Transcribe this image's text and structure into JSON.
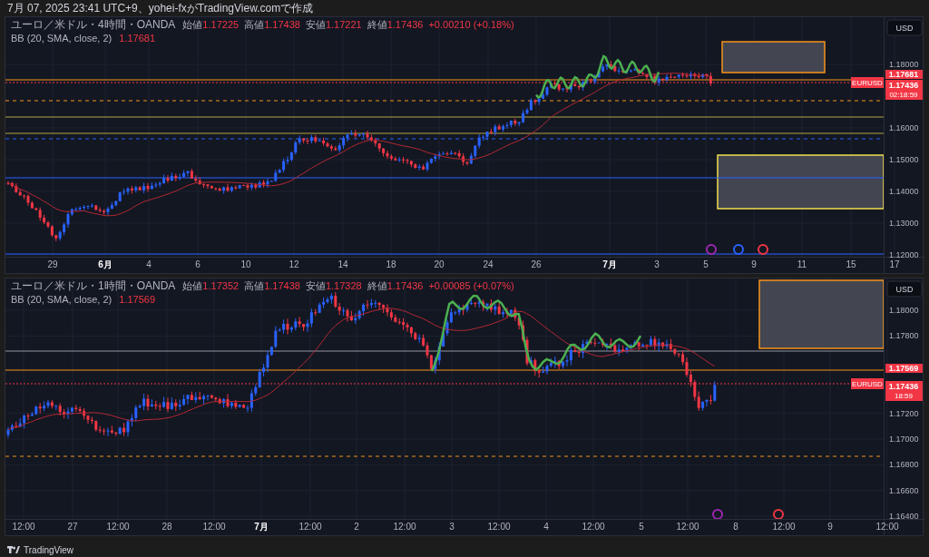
{
  "header": {
    "caption": "7月 07, 2025 23:41 UTC+9、yohei-fxがTradingView.comで作成"
  },
  "panels": [
    {
      "symbol_line": "ユーロ／米ドル・4時間・OANDA",
      "ohlc": [
        {
          "label": "始値",
          "value": "1.17225"
        },
        {
          "label": "高値",
          "value": "1.17438"
        },
        {
          "label": "安値",
          "value": "1.17221"
        },
        {
          "label": "終値",
          "value": "1.17436"
        }
      ],
      "change": "+0.00210 (+0.18%)",
      "indicator": {
        "label": "BB (20, SMA, close, 2)",
        "value": "1.17681"
      },
      "currency": "USD",
      "price_ticks": [
        "1.18000",
        "1.16000",
        "1.15000",
        "1.14000",
        "1.13000",
        "1.12000"
      ],
      "time_ticks": [
        {
          "label": "29",
          "emphasized": false
        },
        {
          "label": "6月",
          "emphasized": true
        },
        {
          "label": "4",
          "emphasized": false
        },
        {
          "label": "6",
          "emphasized": false
        },
        {
          "label": "10",
          "emphasized": false
        },
        {
          "label": "12",
          "emphasized": false
        },
        {
          "label": "14",
          "emphasized": false
        },
        {
          "label": "18",
          "emphasized": false
        },
        {
          "label": "20",
          "emphasized": false
        },
        {
          "label": "24",
          "emphasized": false
        },
        {
          "label": "26",
          "emphasized": false
        },
        {
          "label": "7月",
          "emphasized": true
        },
        {
          "label": "3",
          "emphasized": false
        },
        {
          "label": "5",
          "emphasized": false
        },
        {
          "label": "9",
          "emphasized": false
        },
        {
          "label": "11",
          "emphasized": false
        },
        {
          "label": "15",
          "emphasized": false
        },
        {
          "label": "17",
          "emphasized": false
        }
      ],
      "indicator_tag": "1.17681",
      "symbol_tag": "EURUSD",
      "last_price": "1.17436",
      "countdown": "02:18:59"
    },
    {
      "symbol_line": "ユーロ／米ドル・1時間・OANDA",
      "ohlc": [
        {
          "label": "始値",
          "value": "1.17352"
        },
        {
          "label": "高値",
          "value": "1.17438"
        },
        {
          "label": "安値",
          "value": "1.17328"
        },
        {
          "label": "終値",
          "value": "1.17436"
        }
      ],
      "change": "+0.00085 (+0.07%)",
      "indicator": {
        "label": "BB (20, SMA, close, 2)",
        "value": "1.17569"
      },
      "currency": "USD",
      "price_ticks": [
        "1.18000",
        "1.17800",
        "1.17200",
        "1.17000",
        "1.16800",
        "1.16600",
        "1.16400"
      ],
      "time_ticks": [
        {
          "label": "12:00",
          "emphasized": false
        },
        {
          "label": "27",
          "emphasized": false
        },
        {
          "label": "12:00",
          "emphasized": false
        },
        {
          "label": "28",
          "emphasized": false
        },
        {
          "label": "12:00",
          "emphasized": false
        },
        {
          "label": "7月",
          "emphasized": true
        },
        {
          "label": "12:00",
          "emphasized": false
        },
        {
          "label": "2",
          "emphasized": false
        },
        {
          "label": "12:00",
          "emphasized": false
        },
        {
          "label": "3",
          "emphasized": false
        },
        {
          "label": "12:00",
          "emphasized": false
        },
        {
          "label": "4",
          "emphasized": false
        },
        {
          "label": "12:00",
          "emphasized": false
        },
        {
          "label": "5",
          "emphasized": false
        },
        {
          "label": "12:00",
          "emphasized": false
        },
        {
          "label": "8",
          "emphasized": false
        },
        {
          "label": "12:00",
          "emphasized": false
        },
        {
          "label": "9",
          "emphasized": false
        },
        {
          "label": "12:00",
          "emphasized": false
        }
      ],
      "indicator_tag": "1.17569",
      "symbol_tag": "EURUSD",
      "last_price": "1.17436",
      "countdown": "18:59"
    }
  ],
  "footer": {
    "brand": "TradingView"
  }
}
